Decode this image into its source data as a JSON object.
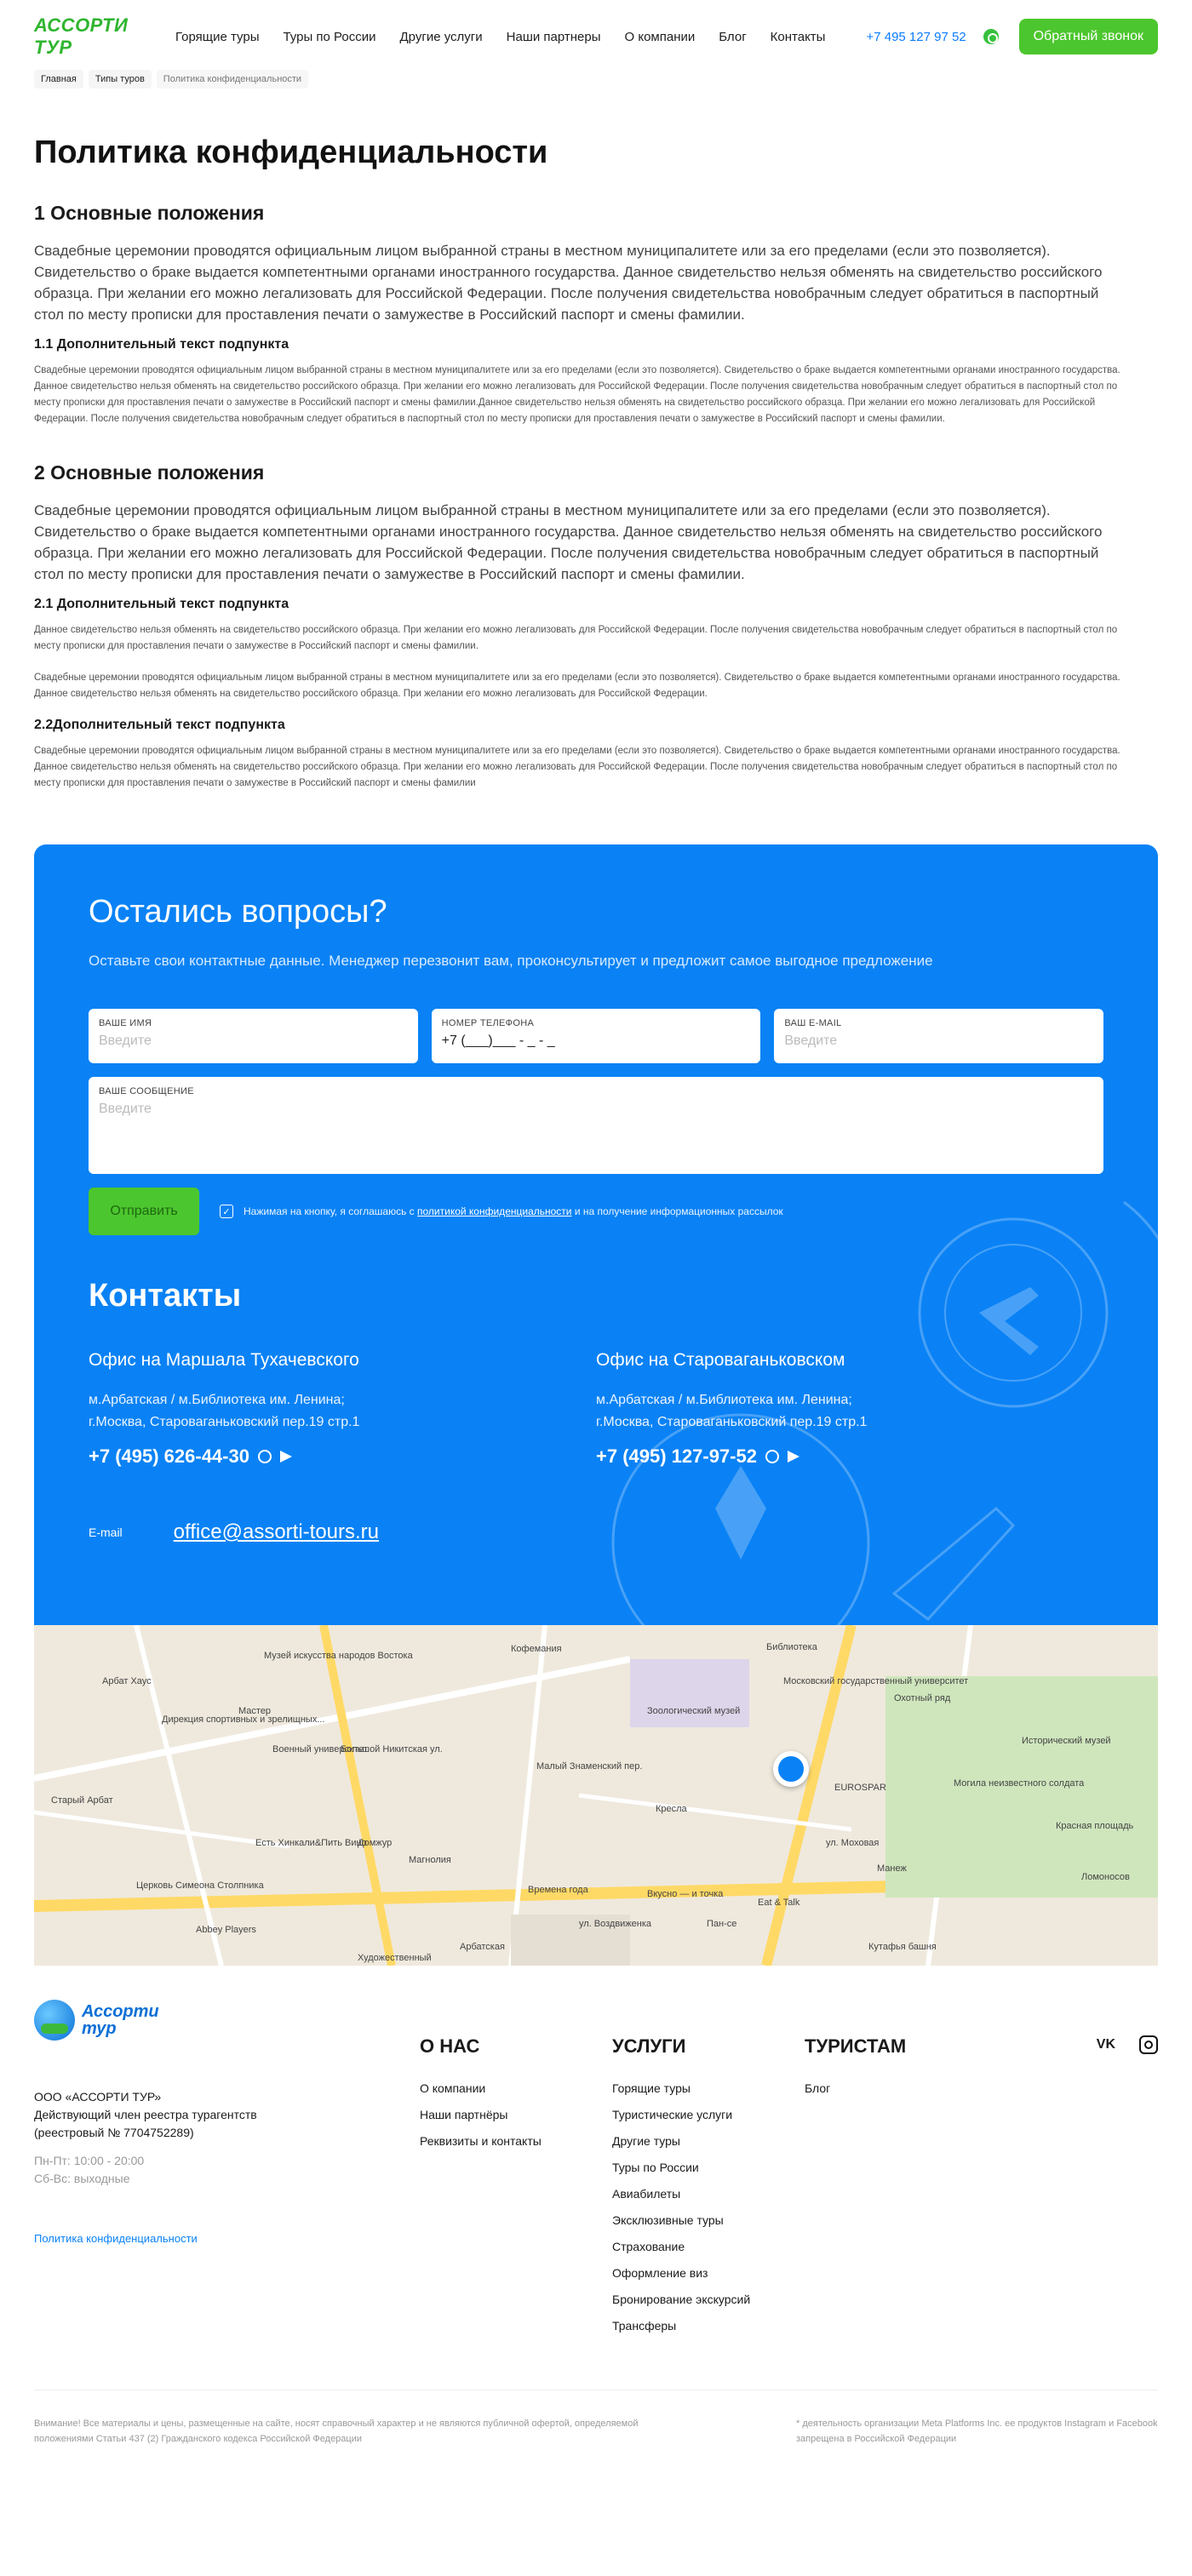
{
  "header": {
    "logo_text": "АССОРТИ ТУР",
    "nav": [
      "Горящие туры",
      "Туры по России",
      "Другие услуги",
      "Наши партнеры",
      "О компании",
      "Блог",
      "Контакты"
    ],
    "phone": "+7 495 127 97 52",
    "callback": "Обратный звонок"
  },
  "breadcrumb": [
    "Главная",
    "Типы туров",
    "Политика конфиденциальности"
  ],
  "policy": {
    "title": "Политика конфиденциальности",
    "s1_title": "1 Основные положения",
    "s1_lead": "Свадебные церемонии проводятся официальным лицом выбранной страны в местном муниципалитете или за его пределами (если это позволяется). Свидетельство о браке выдается компетентными органами иностранного государства. Данное свидетельство нельзя обменять на свидетельство российского образца. При желании его можно легализовать для Российской Федерации. После получения свидетельства новобрачным следует обратиться в паспортный стол по месту прописки для проставления печати о замужестве в Российский паспорт и смены фамилии.",
    "s1_1_title": "1.1 Дополнительный текст подпункта",
    "s1_1_text": "Свадебные церемонии проводятся официальным лицом выбранной страны в местном муниципалитете или за его пределами (если это позволяется). Свидетельство о браке выдается компетентными органами иностранного государства. Данное свидетельство нельзя обменять на свидетельство российского образца. При желании его можно легализовать для Российской Федерации. После получения свидетельства новобрачным следует обратиться в паспортный стол по месту прописки для проставления печати о замужестве в Российский паспорт и смены фамилии.Данное свидетельство нельзя обменять на свидетельство российского образца. При желании его можно легализовать для Российской Федерации. После получения свидетельства новобрачным следует обратиться в паспортный стол по месту прописки для проставления печати о замужестве в Российский паспорт и смены фамилии.",
    "s2_title": "2 Основные положения",
    "s2_lead": "Свадебные церемонии проводятся официальным лицом выбранной страны в местном муниципалитете или за его пределами (если это позволяется). Свидетельство о браке выдается компетентными органами иностранного государства. Данное свидетельство нельзя обменять на свидетельство российского образца. При желании его можно легализовать для Российской Федерации. После получения свидетельства новобрачным следует обратиться в паспортный стол по месту прописки для проставления печати о замужестве в Российский паспорт и смены фамилии.",
    "s2_1_title": "2.1 Дополнительный текст подпункта",
    "s2_1_text_a": " Данное свидетельство нельзя обменять на свидетельство российского образца. При желании его можно легализовать для Российской Федерации. После получения свидетельства новобрачным следует обратиться в паспортный стол по месту прописки для проставления печати о замужестве в Российский паспорт и смены фамилии.",
    "s2_1_text_b": "Свадебные церемонии проводятся официальным лицом выбранной страны в местном муниципалитете или за его пределами (если это позволяется). Свидетельство о браке выдается компетентными органами иностранного государства. Данное свидетельство нельзя обменять на свидетельство российского образца. При желании его можно легализовать для Российской Федерации.",
    "s2_2_title": "2.2Дополнительный текст подпункта",
    "s2_2_text": "Свадебные церемонии проводятся официальным лицом выбранной страны в местном муниципалитете или за его пределами (если это позволяется). Свидетельство о браке выдается компетентными органами иностранного государства. Данное свидетельство нельзя обменять на свидетельство российского образца. При желании его можно легализовать для Российской Федерации. После получения свидетельства новобрачным следует обратиться в паспортный стол по месту прописки для проставления печати о замужестве в Российский паспорт и смены фамилии"
  },
  "questions": {
    "title": "Остались вопросы?",
    "subtitle": "Оставьте свои контактные данные. Менеджер перезвонит вам, проконсультирует и предложит самое выгодное предложение",
    "name_label": "ВАШЕ ИМЯ",
    "name_placeholder": "Введите",
    "phone_label": "НОМЕР ТЕЛЕФОНА",
    "phone_value": "+7 (___)___ - _ - _",
    "email_label": "ВАШ E-MAIL",
    "email_placeholder": "Введите",
    "message_label": "ВАШЕ СООБЩЕНИЕ",
    "message_placeholder": "Введите",
    "submit": "Отправить",
    "consent_before": "Нажимая на кнопку, я соглашаюсь с ",
    "consent_link": "политикой конфиденциальности",
    "consent_after": " и на получение информационных рассылок"
  },
  "contacts": {
    "title": "Контакты",
    "offices": [
      {
        "title": "Офис на Маршала Тухачевского",
        "metro": "м.Арбатская / м.Библиотека им. Ленина;",
        "addr": "г.Москва, Староваганьковский пер.19 стр.1",
        "phone": "+7 (495) 626-44-30"
      },
      {
        "title": "Офис на Староваганьковском",
        "metro": "м.Арбатская / м.Библиотека им. Ленина;",
        "addr": "г.Москва, Староваганьковский пер.19 стр.1",
        "phone": "+7 (495) 127-97-52"
      }
    ],
    "email_label": "E-mail",
    "email": "office@assorti-tours.ru"
  },
  "map": {
    "labels": [
      "Арбат Хаус",
      "Музей искусства народов Востока",
      "Дирекция спортивных и зрелищных...",
      "Мастер",
      "Военный университет",
      "Кофемания",
      "Зоологический музей",
      "Старый Арбат",
      "Московский государственный университет",
      "ул. Воздвиженка",
      "Арбатская",
      "Охотный ряд",
      "Исторический музей",
      "Могила неизвестного солдата",
      "Красная площадь",
      "Abbey Players",
      "Церковь Симеона Столпника",
      "Есть Хинкали&Пить Вино",
      "Домжур",
      "Магнолия",
      "Времена года",
      "Вкусно — и точка",
      "Пан-се",
      "Кутафья башня",
      "Художественный",
      "ул. Моховая",
      "Манеж",
      "EUROSPAR",
      "Кресла",
      "Eat & Talk",
      "Большой Никитская ул.",
      "Малый Знаменский пер.",
      "Библиотека",
      "Ломоносов"
    ]
  },
  "footer": {
    "logo_line1": "Ассорти",
    "logo_line2": "тур",
    "company": "ООО «АССОРТИ ТУР»",
    "registry": "Действующий член реестра турагентств",
    "registry_no": "(реестровый № 7704752289)",
    "hours_weekdays": "Пн-Пт: 10:00 - 20:00",
    "hours_weekend": "Сб-Вс: выходные",
    "policy_link": "Политика конфиденциальности",
    "about_title": "О НАС",
    "about_links": [
      "О компании",
      "Наши партнёры",
      "Реквизиты и контакты"
    ],
    "services_title": "УСЛУГИ",
    "services_links": [
      "Горящие туры",
      "Туристические услуги",
      "Другие туры",
      "Туры по России",
      "Авиабилеты",
      "Эксклюзивные туры",
      "Страхование",
      "Оформление виз",
      "Бронирование экскурсий",
      "Трансферы"
    ],
    "tourists_title": "ТУРИСТАМ",
    "tourists_links": [
      "Блог"
    ],
    "vk": "VK",
    "disclaimer": "Внимание! Все материалы и цены, размещенные на сайте, носят справочный характер и не являются публичной офертой, определяемой положениями Статьи 437 (2) Гражданского кодекса Российской Федерации",
    "meta_note": "* деятельность организации Meta Platforms Inc. ее продуктов Instagram и Facebook запрещена в Российской Федерации"
  },
  "colors": {
    "brand_blue": "#0a82f5",
    "brand_green": "#4cc62e",
    "link_blue": "#0a7bff"
  }
}
